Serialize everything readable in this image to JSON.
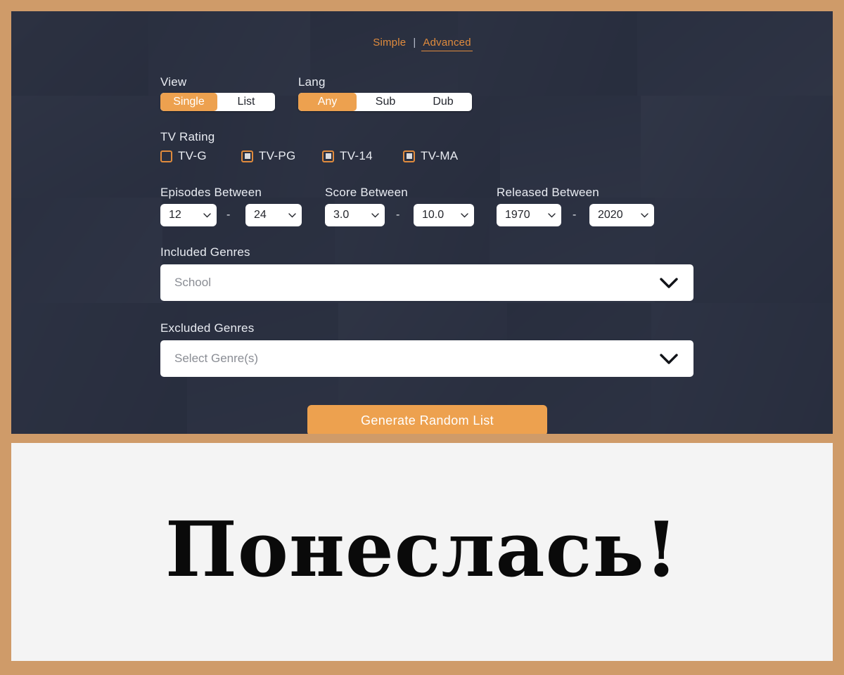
{
  "theme": {
    "frame_color": "#cf9b69",
    "panel_bg": "#2b3040",
    "accent": "#eda14f",
    "accent_text": "#e08b3d",
    "result_bg": "#f4f4f4"
  },
  "mode_tabs": {
    "simple_label": "Simple",
    "separator": "|",
    "advanced_label": "Advanced",
    "active": "Advanced"
  },
  "view": {
    "label": "View",
    "options": [
      "Single",
      "List"
    ],
    "selected": "Single"
  },
  "lang": {
    "label": "Lang",
    "options": [
      "Any",
      "Sub",
      "Dub"
    ],
    "selected": "Any"
  },
  "tv_rating": {
    "label": "TV Rating",
    "items": [
      {
        "label": "TV-G",
        "checked": false
      },
      {
        "label": "TV-PG",
        "checked": true
      },
      {
        "label": "TV-14",
        "checked": true
      },
      {
        "label": "TV-MA",
        "checked": true
      }
    ]
  },
  "episodes": {
    "label": "Episodes Between",
    "min": "12",
    "max": "24",
    "dash": "-"
  },
  "score": {
    "label": "Score Between",
    "min": "3.0",
    "max": "10.0",
    "dash": "-"
  },
  "released": {
    "label": "Released Between",
    "min": "1970",
    "max": "2020",
    "dash": "-"
  },
  "included_genres": {
    "label": "Included Genres",
    "value": "School",
    "placeholder": "Select Genre(s)"
  },
  "excluded_genres": {
    "label": "Excluded Genres",
    "value": "Select Genre(s)",
    "placeholder": "Select Genre(s)"
  },
  "generate": {
    "label": "Generate Random List"
  },
  "result": {
    "text": "Понеслась!"
  }
}
